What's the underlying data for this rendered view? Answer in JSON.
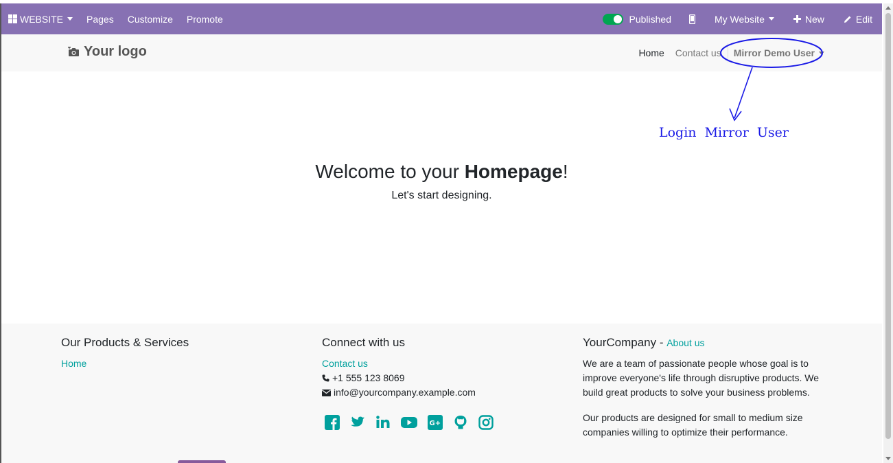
{
  "admin_bar": {
    "app_label": "WEBSITE",
    "menu": [
      "Pages",
      "Customize",
      "Promote"
    ],
    "published_label": "Published",
    "website_label": "My Website",
    "new_label": "New",
    "edit_label": "Edit",
    "published": true,
    "bg_color": "#8771b3"
  },
  "site_header": {
    "logo_text": "Your logo",
    "nav": {
      "home": "Home",
      "contact": "Contact us"
    },
    "user_name": "Mirror Demo User"
  },
  "annotation": {
    "label": "Login Mirror User",
    "color": "#1a1ae6"
  },
  "hero": {
    "title_prefix": "Welcome to your ",
    "title_bold": "Homepage",
    "title_suffix": "!",
    "subtitle": "Let's start designing."
  },
  "footer": {
    "col1": {
      "title": "Our Products & Services",
      "link": "Home"
    },
    "col2": {
      "title": "Connect with us",
      "link": "Contact us",
      "phone": "+1 555 123 8069",
      "email": "info@yourcompany.example.com",
      "socials": [
        "facebook-icon",
        "twitter-icon",
        "linkedin-icon",
        "youtube-icon",
        "google-plus-icon",
        "github-icon",
        "instagram-icon"
      ]
    },
    "col3": {
      "company": "YourCompany",
      "dash": " - ",
      "about_link": "About us",
      "para1": "We are a team of passionate people whose goal is to improve everyone's life through disruptive products. We build great products to solve your business problems.",
      "para2": "Our products are designed for small to medium size companies willing to optimize their performance."
    },
    "accent_color": "#00a09d"
  }
}
